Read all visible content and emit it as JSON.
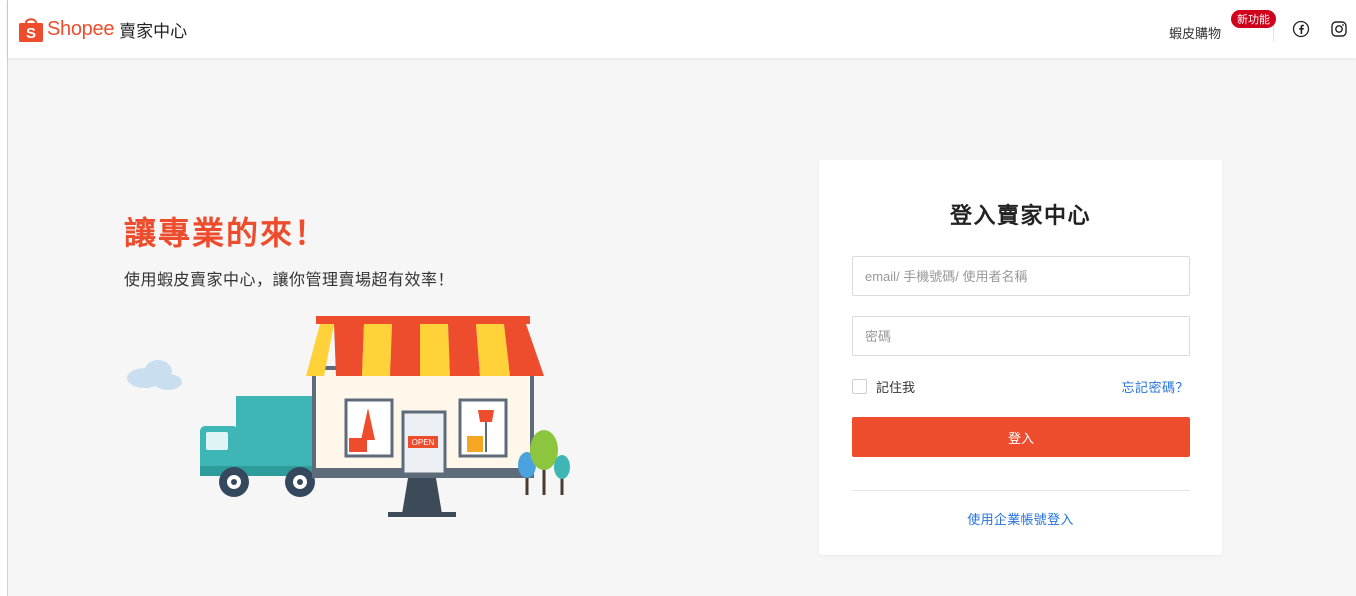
{
  "header": {
    "brand": "Shopee",
    "brand_sub": "賣家中心",
    "shop_link": "蝦皮購物",
    "new_badge": "新功能",
    "icons": [
      "facebook-icon",
      "instagram-icon"
    ]
  },
  "hero": {
    "title": "讓專業的來！",
    "subtitle": "使用蝦皮賣家中心，讓你管理賣場超有效率！",
    "open_sign": "OPEN"
  },
  "login": {
    "title": "登入賣家中心",
    "username_placeholder": "email/ 手機號碼/ 使用者名稱",
    "password_placeholder": "密碼",
    "remember_label": "記住我",
    "forgot_link": "忘記密碼？",
    "submit_label": "登入",
    "corporate_link": "使用企業帳號登入"
  },
  "colors": {
    "brand": "#ee4d2d",
    "link": "#2673dd",
    "badge": "#d0011b",
    "background": "#f6f6f6"
  }
}
